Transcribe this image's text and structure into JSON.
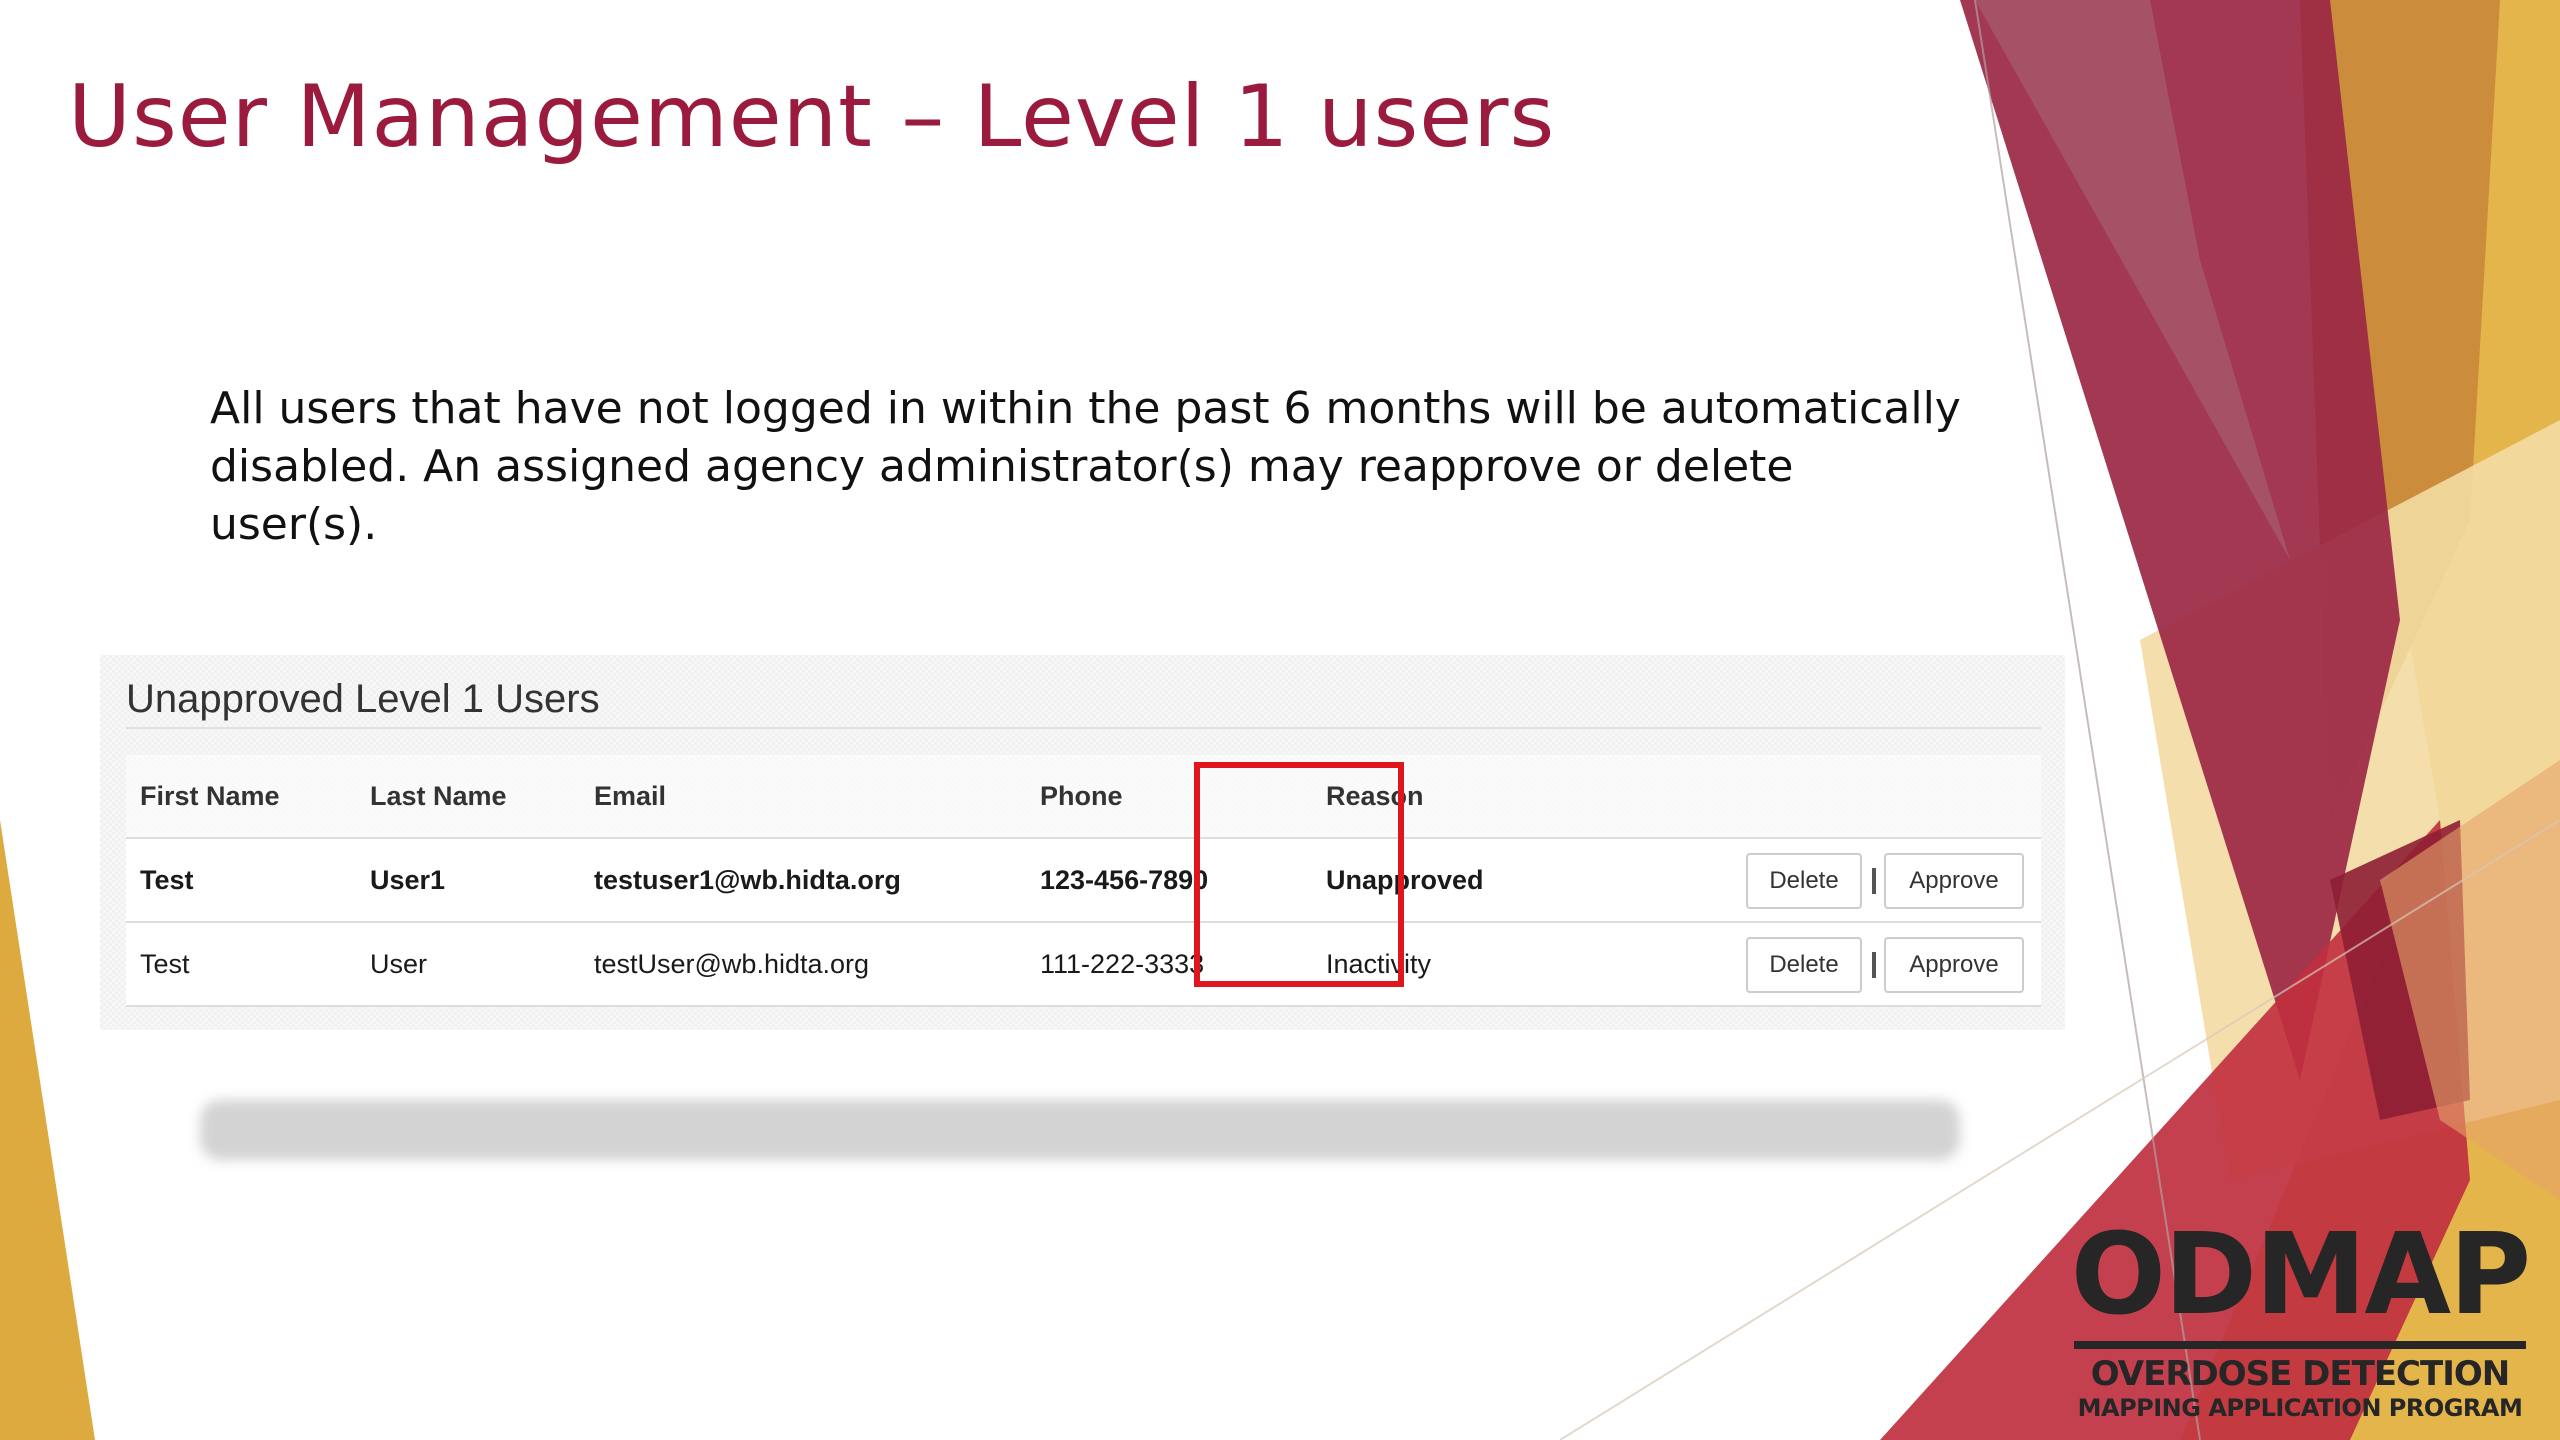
{
  "slide": {
    "title": "User Management – Level 1 users",
    "body": "All users that have not logged in within the past 6 months will be automatically\ndisabled. An assigned agency administrator(s) may reapprove or delete user(s).",
    "title_color": "#9b1b3e"
  },
  "panel": {
    "title": "Unapproved Level 1 Users",
    "columns": [
      "First Name",
      "Last Name",
      "Email",
      "Phone",
      "Reason"
    ],
    "rows": [
      {
        "first_name": "Test",
        "last_name": "User1",
        "email": "testuser1@wb.hidta.org",
        "phone": "123-456-7890",
        "reason": "Unapproved",
        "delete_label": "Delete",
        "approve_label": "Approve"
      },
      {
        "first_name": "Test",
        "last_name": "User",
        "email": "testUser@wb.hidta.org",
        "phone": "111-222-3333",
        "reason": "Inactivity",
        "delete_label": "Delete",
        "approve_label": "Approve"
      }
    ],
    "highlight_color": "#e0161f"
  },
  "logo": {
    "main": "ODMAP",
    "line1": "OVERDOSE DETECTION",
    "line2": "MAPPING APPLICATION PROGRAM"
  },
  "theme": {
    "maroon": "#9b1b3e",
    "gold": "#e2b347",
    "light_gold": "#f1d89a",
    "red": "#c0303f"
  }
}
